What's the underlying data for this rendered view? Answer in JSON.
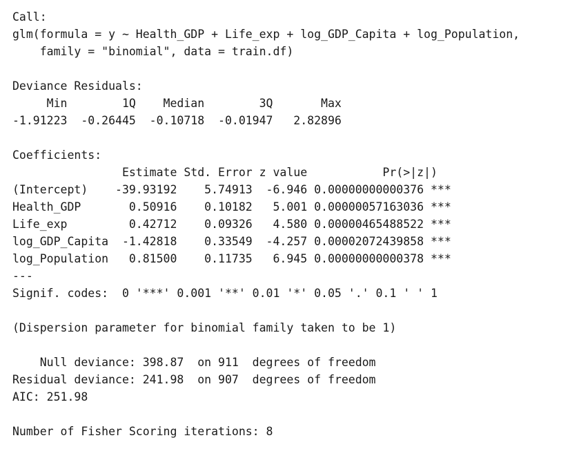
{
  "call": {
    "header": "Call:",
    "line1": "glm(formula = y ~ Health_GDP + Life_exp + log_GDP_Capita + log_Population,",
    "line2": "    family = \"binomial\", data = train.df)"
  },
  "deviance_residuals": {
    "header": "Deviance Residuals:",
    "labels_line": "     Min        1Q    Median        3Q       Max  ",
    "values_line": "-1.91223  -0.26445  -0.10718  -0.01947   2.82896  "
  },
  "coefficients": {
    "header": "Coefficients:",
    "column_line": "                Estimate Std. Error z value           Pr(>|z|)    ",
    "rows": [
      "(Intercept)    -39.93192    5.74913  -6.946 0.00000000000376 ***",
      "Health_GDP       0.50916    0.10182   5.001 0.00000057163036 ***",
      "Life_exp         0.42712    0.09326   4.580 0.00000465488522 ***",
      "log_GDP_Capita  -1.42818    0.33549  -4.257 0.00002072439858 ***",
      "log_Population   0.81500    0.11735   6.945 0.00000000000378 ***"
    ],
    "separator": "---",
    "signif_codes": "Signif. codes:  0 '***' 0.001 '**' 0.01 '*' 0.05 '.' 0.1 ' ' 1"
  },
  "dispersion": "(Dispersion parameter for binomial family taken to be 1)",
  "deviance": {
    "null_line": "    Null deviance: 398.87  on 911  degrees of freedom",
    "residual_line": "Residual deviance: 241.98  on 907  degrees of freedom"
  },
  "aic": "AIC: 251.98",
  "fisher": "Number of Fisher Scoring iterations: 8"
}
